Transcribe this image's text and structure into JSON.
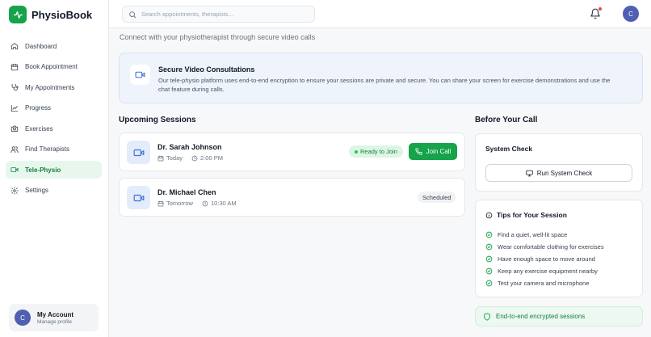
{
  "app": {
    "name": "PhysioBook"
  },
  "sidebar": {
    "items": [
      {
        "label": "Dashboard",
        "icon": "home-icon",
        "active": false
      },
      {
        "label": "Book Appointment",
        "icon": "calendar-icon",
        "active": false
      },
      {
        "label": "My Appointments",
        "icon": "stethoscope-icon",
        "active": false
      },
      {
        "label": "Progress",
        "icon": "chart-icon",
        "active": false
      },
      {
        "label": "Exercises",
        "icon": "camera-icon",
        "active": false
      },
      {
        "label": "Find Therapists",
        "icon": "users-icon",
        "active": false
      },
      {
        "label": "Tele-Physio",
        "icon": "video-icon",
        "active": true
      },
      {
        "label": "Settings",
        "icon": "gear-icon",
        "active": false
      }
    ],
    "account": {
      "initial": "C",
      "name": "My Account",
      "sub": "Manage profile"
    }
  },
  "topbar": {
    "search_placeholder": "Search appointments, therapists...",
    "avatar_initial": "C",
    "has_notification": true
  },
  "main": {
    "subtitle": "Connect with your physiotherapist through secure video calls",
    "banner": {
      "title": "Secure Video Consultations",
      "text": "Our tele-physio platform uses end-to-end encryption to ensure your sessions are private and secure. You can share your screen for exercise demonstrations and use the chat feature during calls."
    },
    "upcoming": {
      "title": "Upcoming Sessions",
      "sessions": [
        {
          "doctor": "Dr. Sarah Johnson",
          "day": "Today",
          "time": "2:00 PM",
          "status": "Ready to Join",
          "action": "Join Call"
        },
        {
          "doctor": "Dr. Michael Chen",
          "day": "Tomorrow",
          "time": "10:30 AM",
          "status": "Scheduled"
        }
      ]
    },
    "before_call": {
      "title": "Before Your Call",
      "system_check": {
        "title": "System Check",
        "button": "Run System Check"
      },
      "tips": {
        "title": "Tips for Your Session",
        "items": [
          "Find a quiet, well-lit space",
          "Wear comfortable clothing for exercises",
          "Have enough space to move around",
          "Keep any exercise equipment nearby",
          "Test your camera and microphone"
        ]
      },
      "encrypted_label": "End-to-end encrypted sessions"
    }
  },
  "colors": {
    "accent": "#16a34a",
    "avatar": "#4f5fb3",
    "video_blue": "#3b6fd8",
    "notification": "#ef4444"
  }
}
